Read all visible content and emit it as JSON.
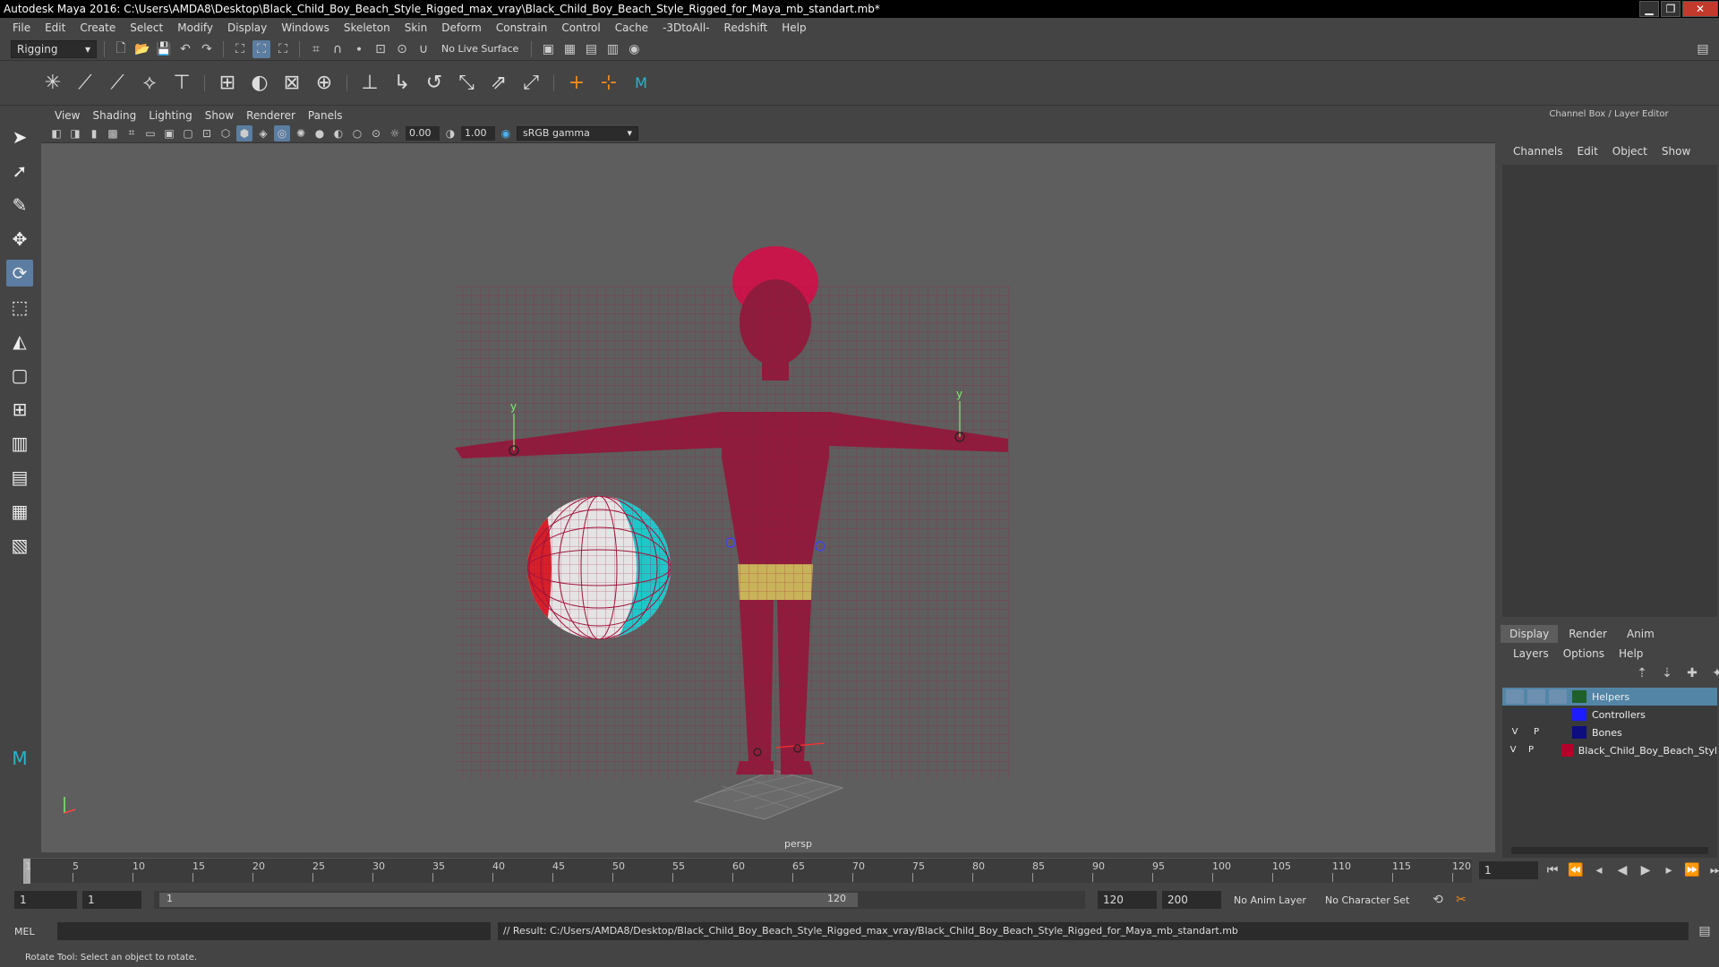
{
  "window": {
    "title": "Autodesk Maya 2016: C:\\Users\\AMDA8\\Desktop\\Black_Child_Boy_Beach_Style_Rigged_max_vray\\Black_Child_Boy_Beach_Style_Rigged_for_Maya_mb_standart.mb*",
    "minimize": "▁",
    "maximize": "❐",
    "close": "✕"
  },
  "menu": [
    "File",
    "Edit",
    "Create",
    "Select",
    "Modify",
    "Display",
    "Windows",
    "Skeleton",
    "Skin",
    "Deform",
    "Constrain",
    "Control",
    "Cache",
    "-3DtoAll-",
    "Redshift",
    "Help"
  ],
  "statusline": {
    "menuset": "Rigging",
    "live_surface": "No Live Surface"
  },
  "panel": {
    "menu": [
      "View",
      "Shading",
      "Lighting",
      "Show",
      "Renderer",
      "Panels"
    ],
    "near": "0.00",
    "far": "1.00",
    "colorspace": "sRGB gamma",
    "camera": "persp"
  },
  "viewport": {
    "axis_y": "y",
    "ball_colors": [
      "#e8e8e8",
      "#d5202a",
      "#21c6c9"
    ]
  },
  "channelbox": {
    "title": "Channel Box / Layer Editor",
    "menu": [
      "Channels",
      "Edit",
      "Object",
      "Show"
    ]
  },
  "layer_editor": {
    "tabs": [
      "Display",
      "Render",
      "Anim"
    ],
    "menu": [
      "Layers",
      "Options",
      "Help"
    ],
    "layers": [
      {
        "v": "",
        "p": "",
        "name": "Helpers",
        "color": "#1f5f2a"
      },
      {
        "v": "",
        "p": "",
        "name": "Controllers",
        "color": "#1c1cff"
      },
      {
        "v": "V",
        "p": "P",
        "name": "Bones",
        "color": "#0d0d80"
      },
      {
        "v": "V",
        "p": "P",
        "name": "Black_Child_Boy_Beach_Styl",
        "color": "#b5002a"
      }
    ]
  },
  "timeline": {
    "ticks": [
      "1",
      "5",
      "10",
      "15",
      "20",
      "25",
      "30",
      "35",
      "40",
      "45",
      "50",
      "55",
      "60",
      "65",
      "70",
      "75",
      "80",
      "85",
      "90",
      "95",
      "100",
      "105",
      "110",
      "115",
      "120"
    ],
    "current_frame": "1"
  },
  "range": {
    "start": "1",
    "playstart": "1",
    "slider_start": "1",
    "slider_end": "120",
    "end": "120",
    "anim_end": "200",
    "anim_layer": "No Anim Layer",
    "char_set": "No Character Set"
  },
  "command": {
    "lang": "MEL",
    "result": "// Result: C:/Users/AMDA8/Desktop/Black_Child_Boy_Beach_Style_Rigged_max_vray/Black_Child_Boy_Beach_Style_Rigged_for_Maya_mb_standart.mb"
  },
  "help": "Rotate Tool: Select an object to rotate."
}
